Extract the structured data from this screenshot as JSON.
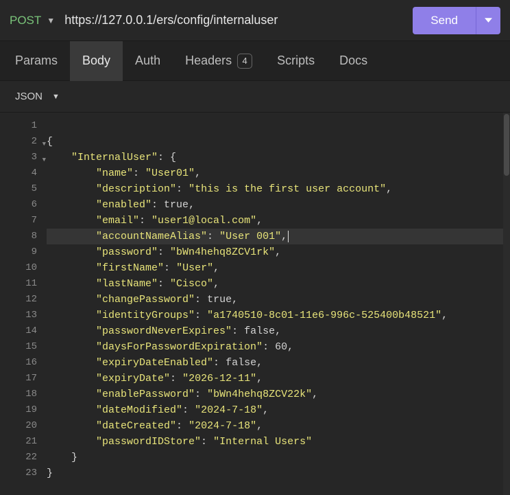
{
  "request": {
    "method": "POST",
    "url": "https://127.0.0.1/ers/config/internaluser",
    "send_label": "Send"
  },
  "tabs": {
    "params": "Params",
    "body": "Body",
    "auth": "Auth",
    "headers": "Headers",
    "headers_count": "4",
    "scripts": "Scripts",
    "docs": "Docs",
    "active": "body"
  },
  "format": {
    "label": "JSON"
  },
  "editor": {
    "highlight_line": 8,
    "lines": [
      {
        "n": 1,
        "indent": 0,
        "tokens": []
      },
      {
        "n": 2,
        "indent": 0,
        "fold": true,
        "tokens": [
          {
            "t": "pn",
            "v": "{"
          }
        ]
      },
      {
        "n": 3,
        "indent": 1,
        "fold": true,
        "tokens": [
          {
            "t": "key",
            "v": "\"InternalUser\""
          },
          {
            "t": "pn",
            "v": ": {"
          }
        ]
      },
      {
        "n": 4,
        "indent": 2,
        "tokens": [
          {
            "t": "key",
            "v": "\"name\""
          },
          {
            "t": "pn",
            "v": ": "
          },
          {
            "t": "str",
            "v": "\"User01\""
          },
          {
            "t": "pn",
            "v": ","
          }
        ]
      },
      {
        "n": 5,
        "indent": 2,
        "tokens": [
          {
            "t": "key",
            "v": "\"description\""
          },
          {
            "t": "pn",
            "v": ": "
          },
          {
            "t": "str",
            "v": "\"this is the first user account\""
          },
          {
            "t": "pn",
            "v": ","
          }
        ]
      },
      {
        "n": 6,
        "indent": 2,
        "tokens": [
          {
            "t": "key",
            "v": "\"enabled\""
          },
          {
            "t": "pn",
            "v": ": "
          },
          {
            "t": "kw",
            "v": "true"
          },
          {
            "t": "pn",
            "v": ","
          }
        ]
      },
      {
        "n": 7,
        "indent": 2,
        "tokens": [
          {
            "t": "key",
            "v": "\"email\""
          },
          {
            "t": "pn",
            "v": ": "
          },
          {
            "t": "str",
            "v": "\"user1@local.com\""
          },
          {
            "t": "pn",
            "v": ","
          }
        ]
      },
      {
        "n": 8,
        "indent": 2,
        "tokens": [
          {
            "t": "key",
            "v": "\"accountNameAlias\""
          },
          {
            "t": "pn",
            "v": ": "
          },
          {
            "t": "str",
            "v": "\"User 001\""
          },
          {
            "t": "pn",
            "v": ","
          },
          {
            "t": "caret",
            "v": ""
          }
        ]
      },
      {
        "n": 9,
        "indent": 2,
        "tokens": [
          {
            "t": "key",
            "v": "\"password\""
          },
          {
            "t": "pn",
            "v": ": "
          },
          {
            "t": "str",
            "v": "\"bWn4hehq8ZCV1rk\""
          },
          {
            "t": "pn",
            "v": ","
          }
        ]
      },
      {
        "n": 10,
        "indent": 2,
        "tokens": [
          {
            "t": "key",
            "v": "\"firstName\""
          },
          {
            "t": "pn",
            "v": ": "
          },
          {
            "t": "str",
            "v": "\"User\""
          },
          {
            "t": "pn",
            "v": ","
          }
        ]
      },
      {
        "n": 11,
        "indent": 2,
        "tokens": [
          {
            "t": "key",
            "v": "\"lastName\""
          },
          {
            "t": "pn",
            "v": ": "
          },
          {
            "t": "str",
            "v": "\"Cisco\""
          },
          {
            "t": "pn",
            "v": ","
          }
        ]
      },
      {
        "n": 12,
        "indent": 2,
        "tokens": [
          {
            "t": "key",
            "v": "\"changePassword\""
          },
          {
            "t": "pn",
            "v": ": "
          },
          {
            "t": "kw",
            "v": "true"
          },
          {
            "t": "pn",
            "v": ","
          }
        ]
      },
      {
        "n": 13,
        "indent": 2,
        "tokens": [
          {
            "t": "key",
            "v": "\"identityGroups\""
          },
          {
            "t": "pn",
            "v": ": "
          },
          {
            "t": "str",
            "v": "\"a1740510-8c01-11e6-996c-525400b48521\""
          },
          {
            "t": "pn",
            "v": ","
          }
        ]
      },
      {
        "n": 14,
        "indent": 2,
        "tokens": [
          {
            "t": "key",
            "v": "\"passwordNeverExpires\""
          },
          {
            "t": "pn",
            "v": ": "
          },
          {
            "t": "kw",
            "v": "false"
          },
          {
            "t": "pn",
            "v": ","
          }
        ]
      },
      {
        "n": 15,
        "indent": 2,
        "tokens": [
          {
            "t": "key",
            "v": "\"daysForPasswordExpiration\""
          },
          {
            "t": "pn",
            "v": ": "
          },
          {
            "t": "num",
            "v": "60"
          },
          {
            "t": "pn",
            "v": ","
          }
        ]
      },
      {
        "n": 16,
        "indent": 2,
        "tokens": [
          {
            "t": "key",
            "v": "\"expiryDateEnabled\""
          },
          {
            "t": "pn",
            "v": ": "
          },
          {
            "t": "kw",
            "v": "false"
          },
          {
            "t": "pn",
            "v": ","
          }
        ]
      },
      {
        "n": 17,
        "indent": 2,
        "tokens": [
          {
            "t": "key",
            "v": "\"expiryDate\""
          },
          {
            "t": "pn",
            "v": ": "
          },
          {
            "t": "str",
            "v": "\"2026-12-11\""
          },
          {
            "t": "pn",
            "v": ","
          }
        ]
      },
      {
        "n": 18,
        "indent": 2,
        "tokens": [
          {
            "t": "key",
            "v": "\"enablePassword\""
          },
          {
            "t": "pn",
            "v": ": "
          },
          {
            "t": "str",
            "v": "\"bWn4hehq8ZCV22k\""
          },
          {
            "t": "pn",
            "v": ","
          }
        ]
      },
      {
        "n": 19,
        "indent": 2,
        "tokens": [
          {
            "t": "key",
            "v": "\"dateModified\""
          },
          {
            "t": "pn",
            "v": ": "
          },
          {
            "t": "str",
            "v": "\"2024-7-18\""
          },
          {
            "t": "pn",
            "v": ","
          }
        ]
      },
      {
        "n": 20,
        "indent": 2,
        "tokens": [
          {
            "t": "key",
            "v": "\"dateCreated\""
          },
          {
            "t": "pn",
            "v": ": "
          },
          {
            "t": "str",
            "v": "\"2024-7-18\""
          },
          {
            "t": "pn",
            "v": ","
          }
        ]
      },
      {
        "n": 21,
        "indent": 2,
        "tokens": [
          {
            "t": "key",
            "v": "\"passwordIDStore\""
          },
          {
            "t": "pn",
            "v": ": "
          },
          {
            "t": "str",
            "v": "\"Internal Users\""
          }
        ]
      },
      {
        "n": 22,
        "indent": 1,
        "tokens": [
          {
            "t": "pn",
            "v": "}"
          }
        ]
      },
      {
        "n": 23,
        "indent": 0,
        "tokens": [
          {
            "t": "pn",
            "v": "}"
          }
        ]
      }
    ]
  }
}
